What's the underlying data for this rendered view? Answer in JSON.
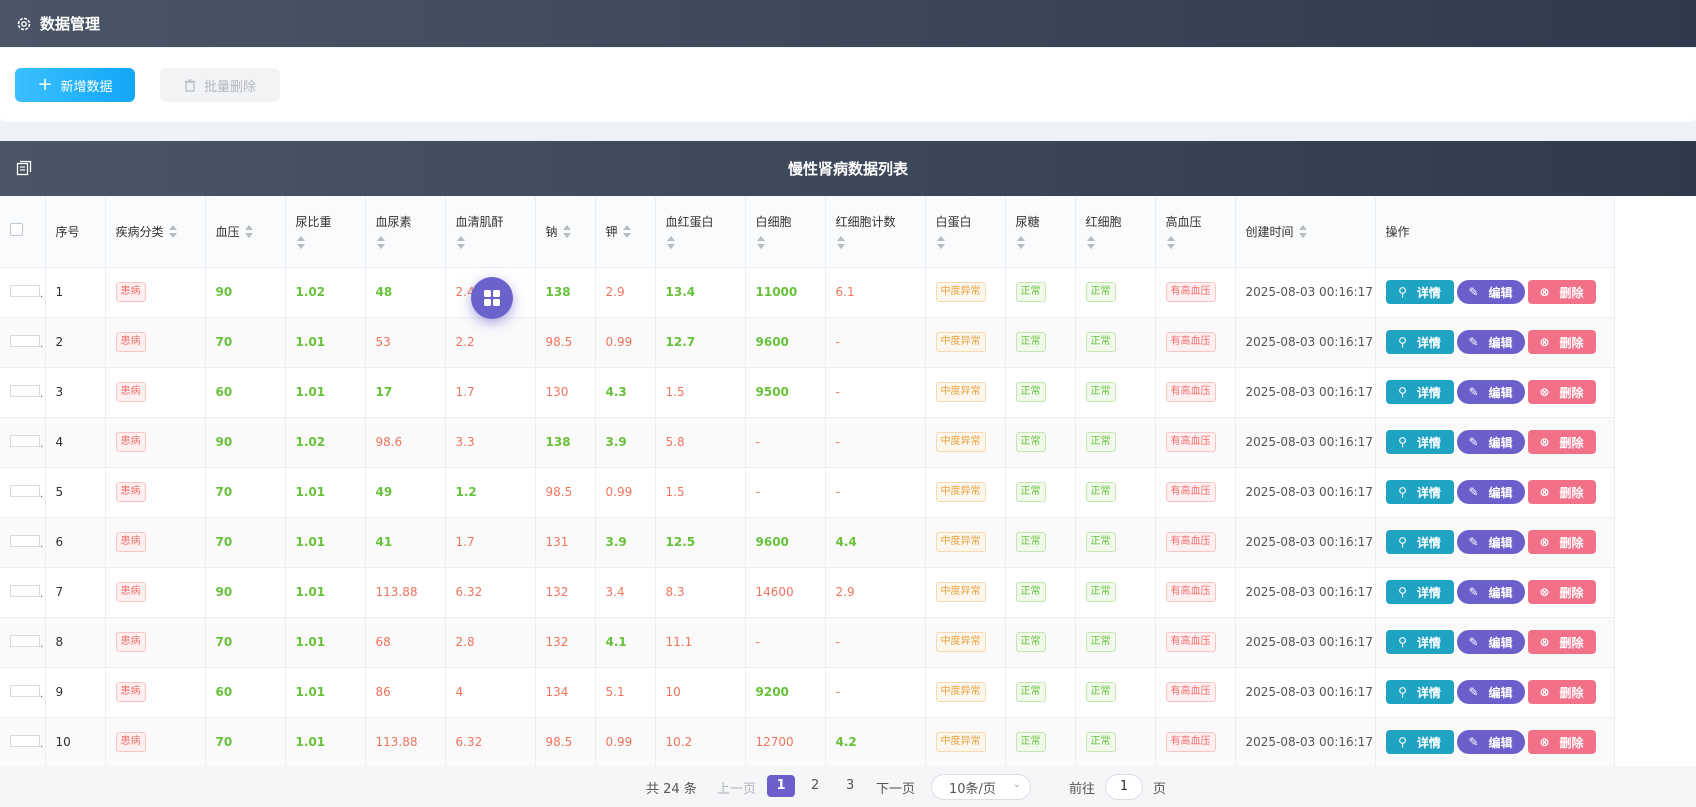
{
  "app": {
    "title": "数据管理"
  },
  "toolbar": {
    "add_label": "新增数据",
    "batch_delete_label": "批量删除"
  },
  "table": {
    "title": "慢性肾病数据列表",
    "columns": [
      "序号",
      "疾病分类",
      "血压",
      "尿比重",
      "血尿素",
      "血清肌酐",
      "钠",
      "钾",
      "血红蛋白",
      "白细胞",
      "红细胞计数",
      "白蛋白",
      "尿糖",
      "红细胞",
      "高血压",
      "创建时间",
      "操作"
    ],
    "action_labels": {
      "detail": "详情",
      "edit": "编辑",
      "delete": "删除"
    },
    "rows": [
      {
        "no": "1",
        "cat": "患病",
        "bp": "90",
        "sg": "1.02",
        "bu": "48",
        "sc": "2.4",
        "na": "138",
        "k": "2.9",
        "hb": "13.4",
        "wbc": "11000",
        "rbcc": "6.1",
        "alb": "中度异常",
        "su": "正常",
        "rbc": "正常",
        "htn": "有高血压",
        "time": "2025-08-03 00:16:17"
      },
      {
        "no": "2",
        "cat": "患病",
        "bp": "70",
        "sg": "1.01",
        "bu": "53",
        "sc": "2.2",
        "na": "98.5",
        "k": "0.99",
        "hb": "12.7",
        "wbc": "9600",
        "rbcc": "-",
        "alb": "中度异常",
        "su": "正常",
        "rbc": "正常",
        "htn": "有高血压",
        "time": "2025-08-03 00:16:17"
      },
      {
        "no": "3",
        "cat": "患病",
        "bp": "60",
        "sg": "1.01",
        "bu": "17",
        "sc": "1.7",
        "na": "130",
        "k": "4.3",
        "hb": "1.5",
        "wbc": "9500",
        "rbcc": "-",
        "alb": "中度异常",
        "su": "正常",
        "rbc": "正常",
        "htn": "有高血压",
        "time": "2025-08-03 00:16:17"
      },
      {
        "no": "4",
        "cat": "患病",
        "bp": "90",
        "sg": "1.02",
        "bu": "98.6",
        "sc": "3.3",
        "na": "138",
        "k": "3.9",
        "hb": "5.8",
        "wbc": "-",
        "rbcc": "-",
        "alb": "中度异常",
        "su": "正常",
        "rbc": "正常",
        "htn": "有高血压",
        "time": "2025-08-03 00:16:17"
      },
      {
        "no": "5",
        "cat": "患病",
        "bp": "70",
        "sg": "1.01",
        "bu": "49",
        "sc": "1.2",
        "na": "98.5",
        "k": "0.99",
        "hb": "1.5",
        "wbc": "-",
        "rbcc": "-",
        "alb": "中度异常",
        "su": "正常",
        "rbc": "正常",
        "htn": "有高血压",
        "time": "2025-08-03 00:16:17"
      },
      {
        "no": "6",
        "cat": "患病",
        "bp": "70",
        "sg": "1.01",
        "bu": "41",
        "sc": "1.7",
        "na": "131",
        "k": "3.9",
        "hb": "12.5",
        "wbc": "9600",
        "rbcc": "4.4",
        "alb": "中度异常",
        "su": "正常",
        "rbc": "正常",
        "htn": "有高血压",
        "time": "2025-08-03 00:16:17"
      },
      {
        "no": "7",
        "cat": "患病",
        "bp": "90",
        "sg": "1.01",
        "bu": "113.88",
        "sc": "6.32",
        "na": "132",
        "k": "3.4",
        "hb": "8.3",
        "wbc": "14600",
        "rbcc": "2.9",
        "alb": "中度异常",
        "su": "正常",
        "rbc": "正常",
        "htn": "有高血压",
        "time": "2025-08-03 00:16:17"
      },
      {
        "no": "8",
        "cat": "患病",
        "bp": "70",
        "sg": "1.01",
        "bu": "68",
        "sc": "2.8",
        "na": "132",
        "k": "4.1",
        "hb": "11.1",
        "wbc": "-",
        "rbcc": "-",
        "alb": "中度异常",
        "su": "正常",
        "rbc": "正常",
        "htn": "有高血压",
        "time": "2025-08-03 00:16:17"
      },
      {
        "no": "9",
        "cat": "患病",
        "bp": "60",
        "sg": "1.01",
        "bu": "86",
        "sc": "4",
        "na": "134",
        "k": "5.1",
        "hb": "10",
        "wbc": "9200",
        "rbcc": "-",
        "alb": "中度异常",
        "su": "正常",
        "rbc": "正常",
        "htn": "有高血压",
        "time": "2025-08-03 00:16:17"
      },
      {
        "no": "10",
        "cat": "患病",
        "bp": "70",
        "sg": "1.01",
        "bu": "113.88",
        "sc": "6.32",
        "na": "98.5",
        "k": "0.99",
        "hb": "10.2",
        "wbc": "12700",
        "rbcc": "4.2",
        "alb": "中度异常",
        "su": "正常",
        "rbc": "正常",
        "htn": "有高血压",
        "time": "2025-08-03 00:16:17"
      }
    ],
    "cell_colors": {
      "bu": [
        "g",
        "r",
        "g",
        "r",
        "g",
        "g",
        "r",
        "r",
        "r",
        "r"
      ],
      "sc": [
        "r",
        "r",
        "r",
        "r",
        "g",
        "r",
        "r",
        "r",
        "r",
        "r"
      ],
      "na": [
        "g",
        "r",
        "r",
        "g",
        "r",
        "r",
        "r",
        "r",
        "r",
        "r"
      ],
      "k": [
        "r",
        "r",
        "g",
        "g",
        "r",
        "g",
        "r",
        "g",
        "r",
        "r"
      ],
      "hb": [
        "g",
        "g",
        "r",
        "r",
        "r",
        "g",
        "r",
        "r",
        "r",
        "r"
      ],
      "wbc": [
        "g",
        "g",
        "g",
        "r",
        "r",
        "g",
        "r",
        "r",
        "g",
        "r"
      ],
      "rbcc": [
        "r",
        "r",
        "r",
        "r",
        "r",
        "g",
        "r",
        "r",
        "r",
        "g"
      ]
    }
  },
  "pagination": {
    "total": "共 24 条",
    "prev": "上一页",
    "pages": [
      "1",
      "2",
      "3"
    ],
    "next": "下一页",
    "size": "10条/页",
    "goto_prefix": "前往",
    "goto_value": "1",
    "goto_suffix": "页"
  },
  "colors": {
    "header_bg": "#3b4657",
    "primary": "#6a5fcb",
    "detail": "#1fa3c2",
    "delete": "#f27088",
    "add": "#1ab0f8"
  }
}
